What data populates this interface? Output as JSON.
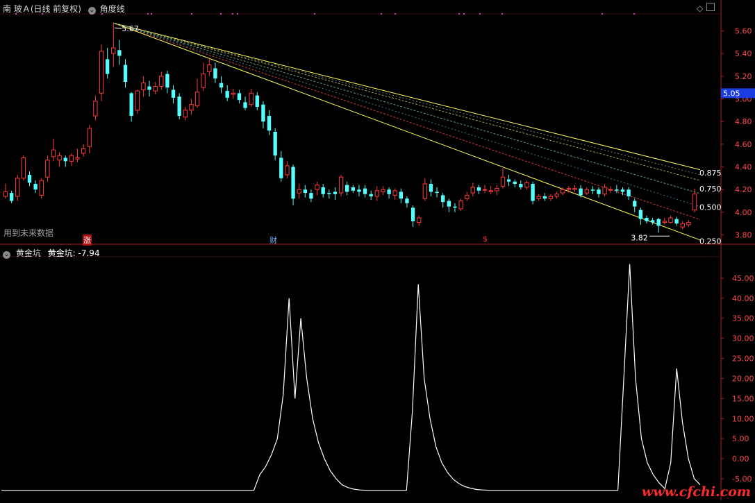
{
  "header": {
    "stock": "南 玻Ａ(日线 前复权)",
    "indicator": "角度线",
    "lower_indicator": "黄金坑",
    "lower_value_label": "黄金坑: -7.94"
  },
  "annotations": {
    "future_data": "用到未来数据",
    "tag_zhang": "涨",
    "tag_cai": "财",
    "tag_dollar": "$",
    "watermark": "www.cfchi.com"
  },
  "colors": {
    "up": "#ff3b3b",
    "down": "#54ffff",
    "axis": "#b02020",
    "fan_upper": "#ffff55",
    "fan_lower": "#ffff55",
    "fan_0875": "#9aa050",
    "fan_0750": "#5aa078",
    "fan_0500": "#c83c3c",
    "fan_0250": "#50a0b4",
    "current_price_bg": "#1a3ce0",
    "lower_line": "#ffffff"
  },
  "chart_data": [
    {
      "type": "candlestick",
      "yticks": [
        "5.60",
        "5.40",
        "5.20",
        "5.00",
        "4.80",
        "4.60",
        "4.40",
        "4.20",
        "4.00",
        "3.80"
      ],
      "ylim": [
        3.73,
        5.75
      ],
      "current_price": "5.05",
      "high_label": "5.67",
      "low_label": "3.82",
      "fan_levels": [
        "0.875",
        "0.750",
        "0.500",
        "0.250"
      ],
      "candles": [
        [
          4.14,
          4.18,
          4.25,
          4.12
        ],
        [
          4.17,
          4.1,
          4.19,
          4.08
        ],
        [
          4.14,
          4.3,
          4.33,
          4.1
        ],
        [
          4.3,
          4.48,
          4.5,
          4.28
        ],
        [
          4.33,
          4.26,
          4.36,
          4.23
        ],
        [
          4.25,
          4.2,
          4.28,
          4.17
        ],
        [
          4.15,
          4.28,
          4.3,
          4.12
        ],
        [
          4.31,
          4.46,
          4.5,
          4.27
        ],
        [
          4.49,
          4.55,
          4.65,
          4.45
        ],
        [
          4.46,
          4.5,
          4.53,
          4.4
        ],
        [
          4.48,
          4.45,
          4.5,
          4.4
        ],
        [
          4.45,
          4.5,
          4.52,
          4.41
        ],
        [
          4.47,
          4.48,
          4.56,
          4.44
        ],
        [
          4.52,
          4.56,
          4.6,
          4.49
        ],
        [
          4.58,
          4.74,
          4.77,
          4.52
        ],
        [
          4.85,
          4.98,
          5.03,
          4.81
        ],
        [
          5.05,
          5.42,
          5.48,
          4.98
        ],
        [
          5.35,
          5.22,
          5.45,
          5.18
        ],
        [
          5.4,
          5.45,
          5.67,
          5.28
        ],
        [
          5.43,
          5.38,
          5.52,
          5.3
        ],
        [
          5.3,
          5.15,
          5.35,
          5.1
        ],
        [
          5.05,
          4.85,
          5.06,
          4.8
        ],
        [
          4.9,
          5.07,
          5.08,
          4.87
        ],
        [
          5.08,
          5.14,
          5.2,
          5.02
        ],
        [
          5.11,
          5.08,
          5.16,
          5.02
        ],
        [
          5.07,
          5.11,
          5.15,
          5.04
        ],
        [
          5.11,
          5.2,
          5.24,
          5.08
        ],
        [
          5.22,
          5.1,
          5.25,
          5.05
        ],
        [
          5.08,
          5.01,
          5.12,
          4.96
        ],
        [
          5.02,
          4.85,
          5.05,
          4.82
        ],
        [
          4.84,
          4.9,
          4.93,
          4.81
        ],
        [
          4.9,
          4.95,
          5.0,
          4.86
        ],
        [
          4.94,
          5.06,
          5.18,
          4.92
        ],
        [
          5.1,
          5.22,
          5.32,
          5.07
        ],
        [
          5.24,
          5.3,
          5.36,
          5.2
        ],
        [
          5.27,
          5.18,
          5.32,
          5.14
        ],
        [
          5.14,
          5.1,
          5.2,
          5.05
        ],
        [
          5.07,
          5.01,
          5.12,
          4.98
        ],
        [
          5.04,
          5.05,
          5.09,
          5.0
        ],
        [
          5.05,
          4.99,
          5.08,
          4.96
        ],
        [
          4.97,
          4.92,
          5.02,
          4.9
        ],
        [
          4.95,
          5.05,
          5.09,
          4.93
        ],
        [
          5.03,
          4.93,
          5.06,
          4.9
        ],
        [
          4.95,
          4.8,
          4.98,
          4.74
        ],
        [
          4.85,
          4.72,
          4.9,
          4.68
        ],
        [
          4.71,
          4.5,
          4.74,
          4.46
        ],
        [
          4.48,
          4.3,
          4.54,
          4.27
        ],
        [
          4.33,
          4.41,
          4.45,
          4.3
        ],
        [
          4.4,
          4.12,
          4.42,
          4.06
        ],
        [
          4.17,
          4.2,
          4.25,
          4.12
        ],
        [
          4.2,
          4.17,
          4.24,
          4.13
        ],
        [
          4.17,
          4.12,
          4.2,
          4.09
        ],
        [
          4.2,
          4.24,
          4.27,
          4.15
        ],
        [
          4.22,
          4.16,
          4.25,
          4.13
        ],
        [
          4.17,
          4.16,
          4.2,
          4.12
        ],
        [
          4.18,
          4.16,
          4.22,
          4.11
        ],
        [
          4.17,
          4.31,
          4.33,
          4.14
        ],
        [
          4.24,
          4.18,
          4.27,
          4.15
        ],
        [
          4.22,
          4.19,
          4.24,
          4.17
        ],
        [
          4.2,
          4.18,
          4.24,
          4.14
        ],
        [
          4.21,
          4.16,
          4.24,
          4.13
        ],
        [
          4.16,
          4.14,
          4.19,
          4.11
        ],
        [
          4.14,
          4.19,
          4.23,
          4.1
        ],
        [
          4.18,
          4.2,
          4.23,
          4.15
        ],
        [
          4.2,
          4.16,
          4.22,
          4.12
        ],
        [
          4.15,
          4.19,
          4.21,
          4.11
        ],
        [
          4.18,
          4.12,
          4.21,
          4.08
        ],
        [
          4.12,
          4.08,
          4.14,
          4.04
        ],
        [
          4.04,
          3.92,
          4.06,
          3.87
        ],
        [
          3.91,
          3.95,
          3.97,
          3.88
        ],
        [
          4.12,
          4.25,
          4.3,
          4.1
        ],
        [
          4.25,
          4.18,
          4.29,
          4.14
        ],
        [
          4.18,
          4.17,
          4.22,
          4.13
        ],
        [
          4.15,
          4.09,
          4.17,
          4.04
        ],
        [
          4.1,
          4.05,
          4.12,
          4.0
        ],
        [
          4.05,
          4.04,
          4.08,
          4.0
        ],
        [
          4.03,
          4.1,
          4.12,
          4.01
        ],
        [
          4.12,
          4.15,
          4.18,
          4.1
        ],
        [
          4.17,
          4.22,
          4.26,
          4.14
        ],
        [
          4.22,
          4.19,
          4.24,
          4.16
        ],
        [
          4.2,
          4.2,
          4.24,
          4.17
        ],
        [
          4.18,
          4.19,
          4.23,
          4.16
        ],
        [
          4.19,
          4.21,
          4.24,
          4.15
        ],
        [
          4.23,
          4.31,
          4.39,
          4.21
        ],
        [
          4.29,
          4.27,
          4.33,
          4.23
        ],
        [
          4.27,
          4.25,
          4.29,
          4.22
        ],
        [
          4.25,
          4.22,
          4.28,
          4.2
        ],
        [
          4.22,
          4.26,
          4.28,
          4.2
        ],
        [
          4.25,
          4.1,
          4.27,
          4.07
        ],
        [
          4.12,
          4.14,
          4.16,
          4.1
        ],
        [
          4.14,
          4.12,
          4.17,
          4.1
        ],
        [
          4.12,
          4.14,
          4.16,
          4.1
        ],
        [
          4.14,
          4.16,
          4.18,
          4.12
        ],
        [
          4.17,
          4.2,
          4.22,
          4.15
        ],
        [
          4.2,
          4.21,
          4.23,
          4.17
        ],
        [
          4.2,
          4.21,
          4.24,
          4.18
        ],
        [
          4.21,
          4.15,
          4.24,
          4.13
        ],
        [
          4.17,
          4.2,
          4.22,
          4.15
        ],
        [
          4.2,
          4.19,
          4.23,
          4.16
        ],
        [
          4.2,
          4.16,
          4.22,
          4.13
        ],
        [
          4.16,
          4.22,
          4.25,
          4.14
        ],
        [
          4.2,
          4.2,
          4.23,
          4.17
        ],
        [
          4.2,
          4.19,
          4.24,
          4.17
        ],
        [
          4.2,
          4.18,
          4.22,
          4.15
        ],
        [
          4.2,
          4.14,
          4.22,
          4.11
        ],
        [
          4.1,
          4.05,
          4.12,
          4.0
        ],
        [
          4.02,
          3.94,
          4.04,
          3.89
        ],
        [
          3.95,
          3.92,
          3.97,
          3.9
        ],
        [
          3.93,
          3.91,
          3.95,
          3.89
        ],
        [
          3.94,
          3.88,
          3.95,
          3.82
        ],
        [
          3.91,
          3.92,
          3.95,
          3.89
        ],
        [
          3.91,
          3.95,
          3.97,
          3.9
        ],
        [
          3.94,
          3.9,
          3.96,
          3.88
        ],
        [
          3.87,
          3.9,
          3.92,
          3.85
        ],
        [
          3.89,
          3.91,
          3.93,
          3.87
        ],
        [
          4.02,
          4.16,
          4.21,
          4.0
        ]
      ]
    },
    {
      "type": "line",
      "name": "黄金坑",
      "yticks": [
        "45.00",
        "40.00",
        "35.00",
        "30.00",
        "25.00",
        "20.00",
        "15.00",
        "10.00",
        "5.00",
        "0.00",
        "-5.00"
      ],
      "ylim": [
        -9.5,
        50
      ],
      "values": [
        -7.9,
        -7.9,
        -7.9,
        -7.9,
        -7.9,
        -7.9,
        -7.9,
        -7.9,
        -7.9,
        -7.9,
        -7.9,
        -7.9,
        -7.9,
        -7.9,
        -7.9,
        -7.9,
        -7.9,
        -7.9,
        -7.9,
        -7.9,
        -7.9,
        -7.9,
        -7.9,
        -7.9,
        -7.9,
        -7.9,
        -7.9,
        -7.9,
        -7.9,
        -7.9,
        -7.9,
        -7.9,
        -7.9,
        -7.9,
        -7.9,
        -7.9,
        -7.9,
        -7.9,
        -7.9,
        -7.9,
        -7.9,
        -7.9,
        -7.9,
        -7.9,
        -4,
        -2,
        1,
        5,
        16,
        40,
        15,
        35,
        20,
        10,
        4,
        0,
        -3,
        -5,
        -6.5,
        -7.2,
        -7.6,
        -7.8,
        -7.9,
        -7.9,
        -7.9,
        -7.9,
        -7.9,
        -7.9,
        -7.9,
        -7.9,
        12,
        43.5,
        20,
        10,
        3,
        -1,
        -3.5,
        -5.2,
        -6.3,
        -7,
        -7.4,
        -7.7,
        -7.8,
        -7.9,
        -7.9,
        -7.9,
        -7.9,
        -7.9,
        -7.9,
        -7.9,
        -7.9,
        -7.9,
        -7.9,
        -7.9,
        -7.9,
        -7.9,
        -7.9,
        -7.9,
        -7.9,
        -7.9,
        -7.9,
        -7.9,
        -7.9,
        -7.9,
        -7.9,
        -7.9,
        20,
        48.5,
        20,
        5,
        -1,
        -4,
        -6,
        -7.5,
        -1,
        22.5,
        9,
        0,
        -5,
        -6.5
      ]
    }
  ]
}
